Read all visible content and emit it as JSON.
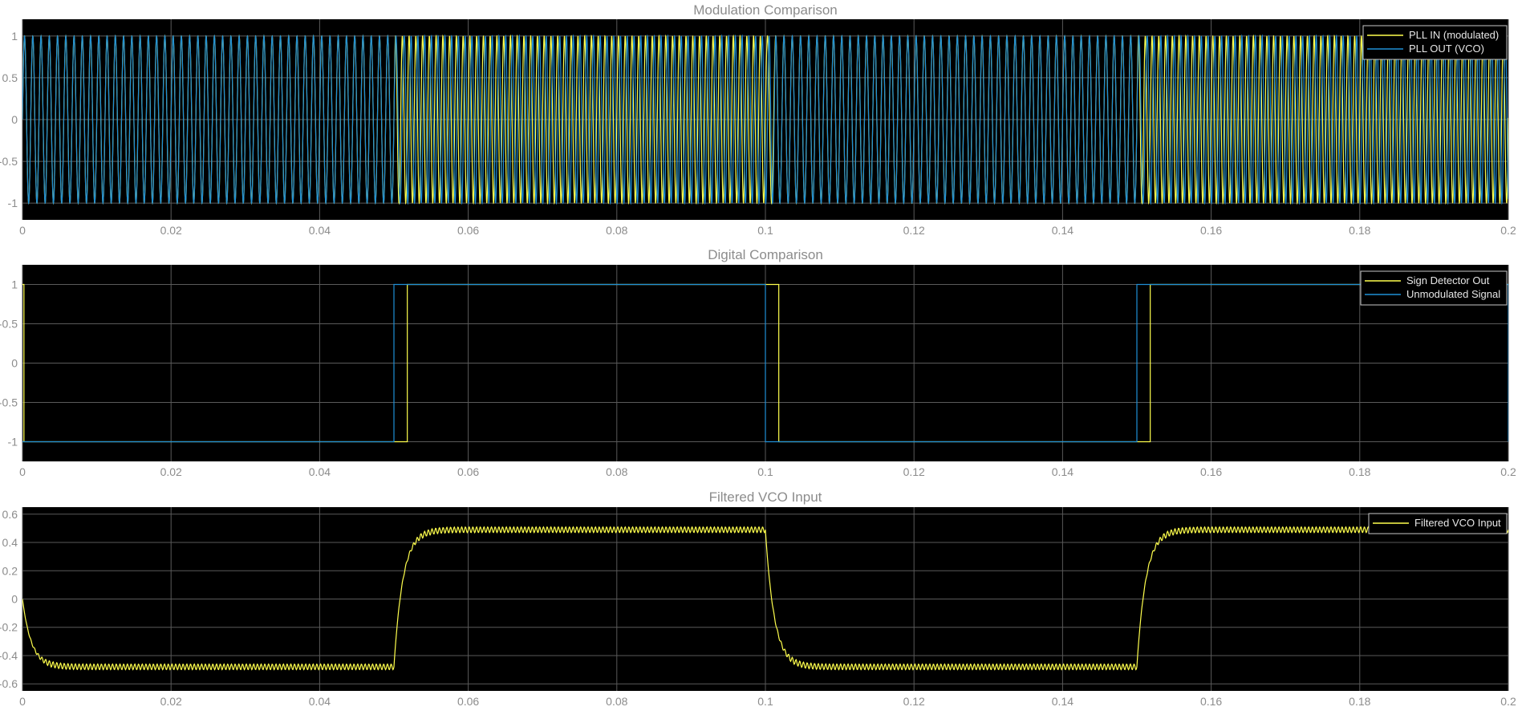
{
  "colors": {
    "figure_background": "#ffffff",
    "axes_background": "#000000",
    "grid": "#5a5a5a",
    "text": "#8c8c8c",
    "legend_background": "#000000",
    "legend_border": "#c8c8c8",
    "legend_text": "#e6e6e6"
  },
  "chart_data": [
    {
      "type": "line",
      "title": "Modulation Comparison",
      "xlabel": "",
      "ylabel": "",
      "xlim": [
        0,
        0.2
      ],
      "ylim": [
        -1.2,
        1.2
      ],
      "grid": true,
      "legend_position": "top-right",
      "x_ticks": [
        0,
        0.02,
        0.04,
        0.06,
        0.08,
        0.1,
        0.12,
        0.14,
        0.16,
        0.18,
        0.2
      ],
      "x_tick_labels": [
        "0",
        "0.02",
        "0.04",
        "0.06",
        "0.08",
        "0.1",
        "0.12",
        "0.14",
        "0.16",
        "0.18",
        "0.2"
      ],
      "y_ticks": [
        -1,
        -0.5,
        0,
        0.5,
        1
      ],
      "y_tick_labels": [
        "-1",
        "-0.5",
        "0",
        "0.5",
        "1"
      ],
      "series": [
        {
          "name": "PLL IN (modulated)",
          "color": "#ffff4d",
          "kind": "modulated_sinusoid",
          "amplitude": 1,
          "carrier_frequency_hz": 1000,
          "frequency_deviation_hz": 100,
          "frequency_shift_times": [
            0.0,
            0.05,
            0.1,
            0.15
          ],
          "symbol_levels": [
            -1,
            1,
            -1,
            1
          ]
        },
        {
          "name": "PLL OUT (VCO)",
          "color": "#1f8fd6",
          "kind": "vco_sinusoid",
          "amplitude": 1,
          "center_frequency_hz": 1000,
          "frequency_deviation_hz": 100,
          "lock_lag": 0.0015,
          "symbol_levels": [
            -1,
            1,
            -1,
            1
          ]
        }
      ]
    },
    {
      "type": "line",
      "title": "Digital Comparison",
      "xlabel": "",
      "ylabel": "",
      "xlim": [
        0,
        0.2
      ],
      "ylim": [
        -1.25,
        1.25
      ],
      "grid": true,
      "legend_position": "top-right",
      "x_ticks": [
        0,
        0.02,
        0.04,
        0.06,
        0.08,
        0.1,
        0.12,
        0.14,
        0.16,
        0.18,
        0.2
      ],
      "x_tick_labels": [
        "0",
        "0.02",
        "0.04",
        "0.06",
        "0.08",
        "0.1",
        "0.12",
        "0.14",
        "0.16",
        "0.18",
        "0.2"
      ],
      "y_ticks": [
        -1,
        -0.5,
        0,
        0.5,
        1
      ],
      "y_tick_labels": [
        "-1",
        "-0.5",
        "0",
        "-0.5",
        "1"
      ],
      "series": [
        {
          "name": "Sign Detector Out",
          "color": "#ffff4d",
          "x": [
            0,
            0.0002,
            0.0002,
            0.0518,
            0.0518,
            0.1018,
            0.1018,
            0.1518,
            0.1518,
            0.2
          ],
          "values": [
            1,
            1,
            -1,
            -1,
            1,
            1,
            -1,
            -1,
            1,
            1
          ]
        },
        {
          "name": "Unmodulated Signal",
          "color": "#1f8fd6",
          "x": [
            0,
            0.05,
            0.05,
            0.1,
            0.1,
            0.15,
            0.15,
            0.2,
            0.2
          ],
          "values": [
            -1,
            -1,
            1,
            1,
            -1,
            -1,
            1,
            1,
            -1
          ]
        }
      ]
    },
    {
      "type": "line",
      "title": "Filtered VCO Input",
      "xlabel": "",
      "ylabel": "",
      "xlim": [
        0,
        0.2
      ],
      "ylim": [
        -0.65,
        0.65
      ],
      "grid": true,
      "legend_position": "top-right",
      "x_ticks": [
        0,
        0.02,
        0.04,
        0.06,
        0.08,
        0.1,
        0.12,
        0.14,
        0.16,
        0.18,
        0.2
      ],
      "x_tick_labels": [
        "0",
        "0.02",
        "0.04",
        "0.06",
        "0.08",
        "0.1",
        "0.12",
        "0.14",
        "0.16",
        "0.18",
        "0.2"
      ],
      "y_ticks": [
        -0.6,
        -0.4,
        -0.2,
        0,
        0.2,
        0.4,
        0.6
      ],
      "y_tick_labels": [
        "-0.6",
        "-0.4",
        "-0.2",
        "0",
        "0.2",
        "0.4",
        "0.6"
      ],
      "series": [
        {
          "name": "Filtered VCO Input",
          "color": "#ffff4d",
          "kind": "filtered_response",
          "steady_levels": [
            -0.48,
            0.49,
            -0.48,
            0.49
          ],
          "segment_starts": [
            0.0,
            0.05,
            0.1,
            0.15
          ],
          "settling_time_constant": 0.0012,
          "ripple_amplitude": 0.02,
          "ripple_frequency_hz": 2000
        }
      ]
    }
  ]
}
